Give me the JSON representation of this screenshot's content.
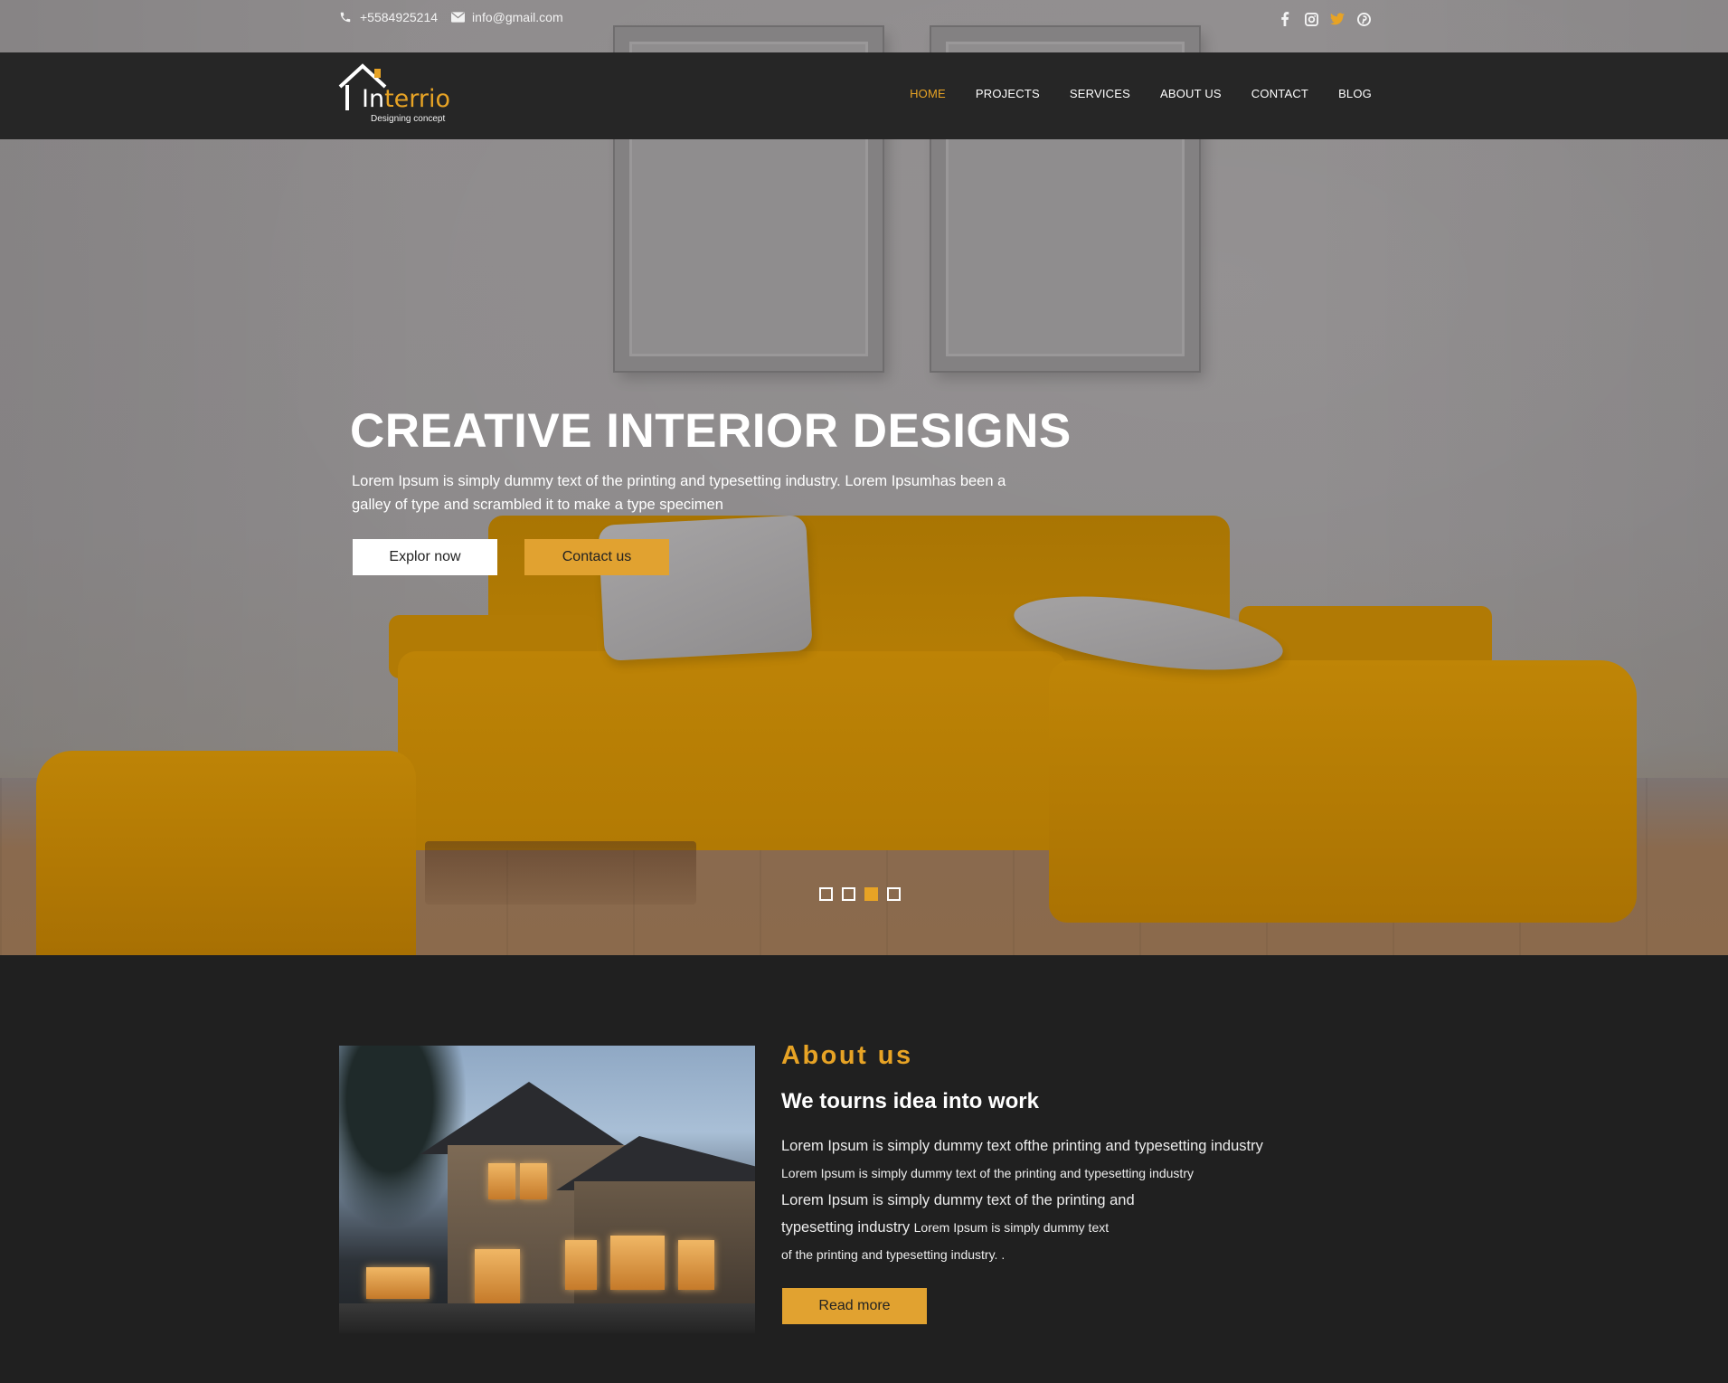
{
  "topbar": {
    "phone": "+5584925214",
    "email": "info@gmail.com",
    "social": [
      {
        "name": "facebook-icon",
        "glyph": "f"
      },
      {
        "name": "instagram-icon",
        "glyph": "◙"
      },
      {
        "name": "twitter-icon",
        "glyph": "🐦"
      },
      {
        "name": "pinterest-icon",
        "glyph": "℗"
      }
    ]
  },
  "brand": {
    "name_prefix": "In",
    "name_suffix": "terrio",
    "tagline": "Designing concept",
    "accent_color": "#e7a325"
  },
  "nav": {
    "items": [
      {
        "label": "HOME",
        "active": true
      },
      {
        "label": "PROJECTS",
        "active": false
      },
      {
        "label": "SERVICES",
        "active": false
      },
      {
        "label": "ABOUT US",
        "active": false
      },
      {
        "label": "CONTACT",
        "active": false
      },
      {
        "label": "BLOG",
        "active": false
      }
    ]
  },
  "hero": {
    "title": "CREATIVE INTERIOR DESIGNS",
    "description": "Lorem Ipsum is simply dummy text of the printing and typesetting industry. Lorem Ipsumhas been a galley of type and scrambled it to make a type specimen",
    "primary_button": "Explor now",
    "secondary_button": "Contact us",
    "slides_count": 4,
    "active_slide": 3
  },
  "about": {
    "heading": "About us",
    "subheading": "We tourns idea into work",
    "lines": [
      "Lorem Ipsum is simply dummy text ofthe printing and typesetting industry",
      "Lorem Ipsum is simply dummy  text of the printing and typesetting industry",
      "Lorem Ipsum is simply dummy text of the printing and",
      "typesetting industry",
      "Lorem Ipsum is simply dummy text",
      "of the printing and typesetting industry. ."
    ],
    "button": "Read more"
  }
}
